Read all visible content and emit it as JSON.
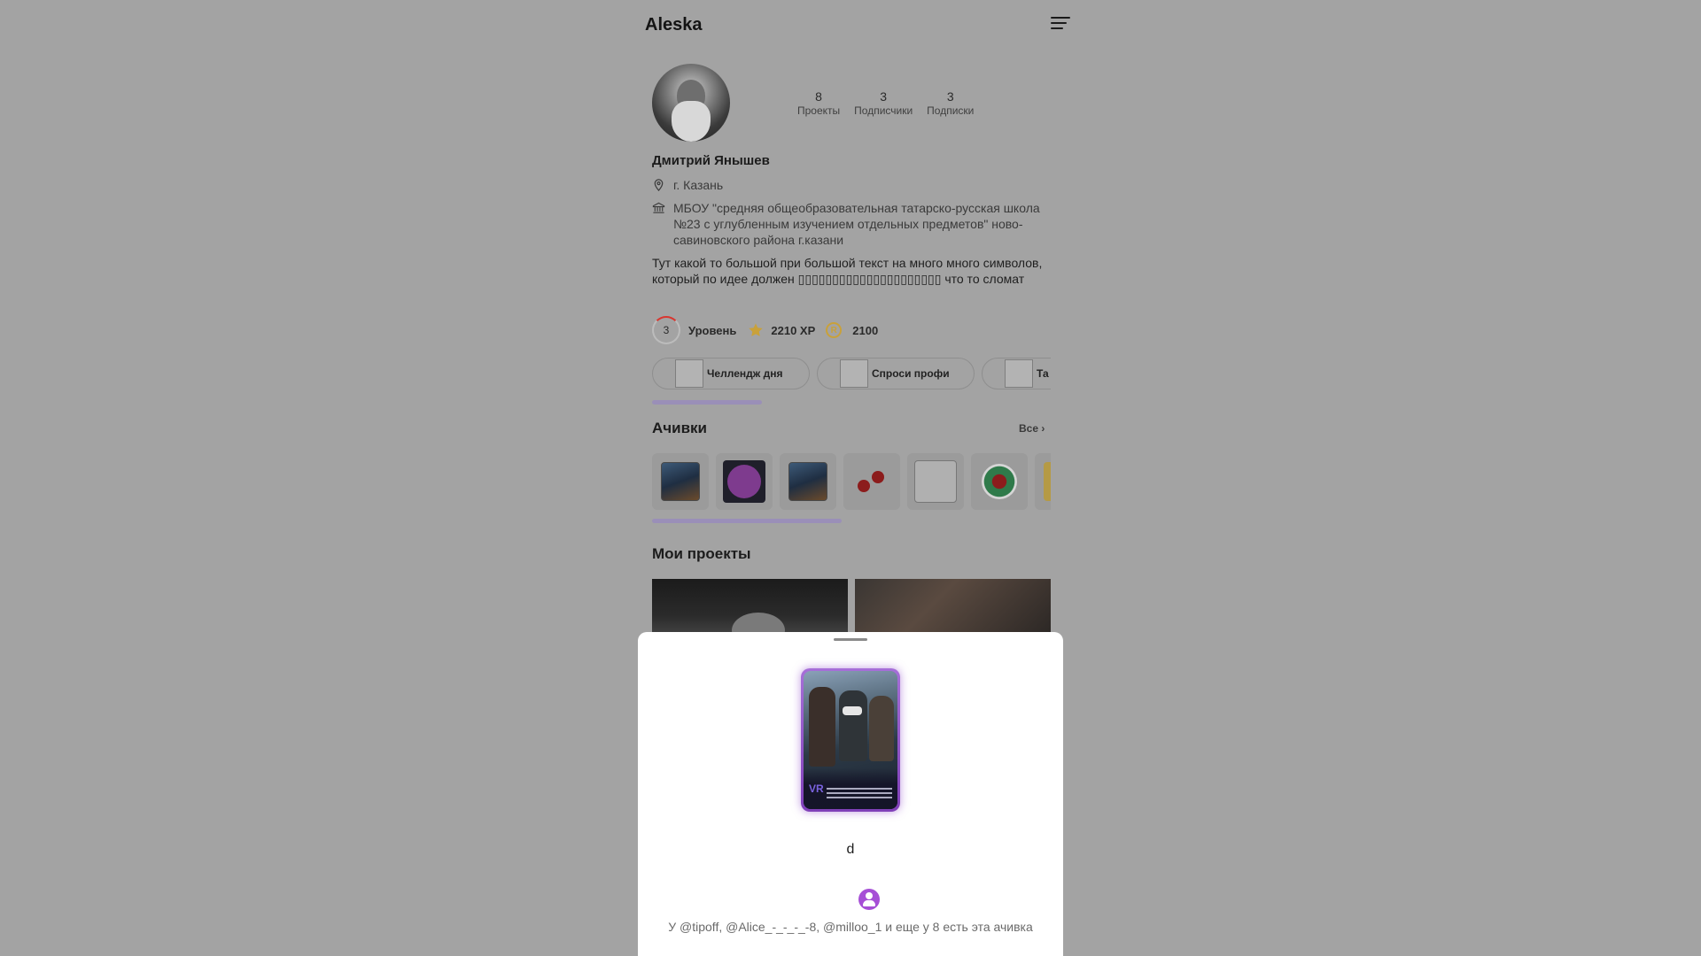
{
  "header": {
    "app_title": "Aleska"
  },
  "profile": {
    "stats": [
      {
        "value": "8",
        "label": "Проекты"
      },
      {
        "value": "3",
        "label": "Подписчики"
      },
      {
        "value": "3",
        "label": "Подписки"
      }
    ],
    "name": "Дмитрий Янышев",
    "city": "г. Казань",
    "school": "МБОУ \"средняя общеобразовательная татарско-русская школа №23 с углубленным изучением отдельных предметов\" ново-савиновского района г.казани",
    "bio": "Тут какой то большой при большой текст на много много символов, который по идее должен ▯▯▯▯▯▯▯▯▯▯▯▯▯▯▯▯▯▯▯▯▯ что то сломат",
    "level": "3",
    "level_label": "Уровень",
    "xp": "2210 XP",
    "coin_symbol": "R",
    "coins": "2100"
  },
  "chips": [
    {
      "label": "Челлендж дня"
    },
    {
      "label": "Спроси профи"
    },
    {
      "label": "Та"
    }
  ],
  "achievements": {
    "title": "Ачивки",
    "see_all": "Все ›",
    "items": [
      "vr-badge",
      "purple-monster-badge",
      "vr-badge",
      "dumbbell-badge",
      "empty-badge",
      "emblem-badge",
      "gold-badge"
    ]
  },
  "projects": {
    "title": "Мои проекты"
  },
  "sheet": {
    "achievement_name": "d",
    "owners_text": "У @tipoff, @Alice_-_-_-_-8, @milloo_1 и еще у 8 есть эта ачивка",
    "card_tag": "VR"
  },
  "colors": {
    "overlay": "#a3a3a3",
    "accent_purple": "#a64fd6",
    "coin_gold": "#c9a13a",
    "star": "#c9a13a",
    "scroll_indicator": "#9a8fb8"
  }
}
